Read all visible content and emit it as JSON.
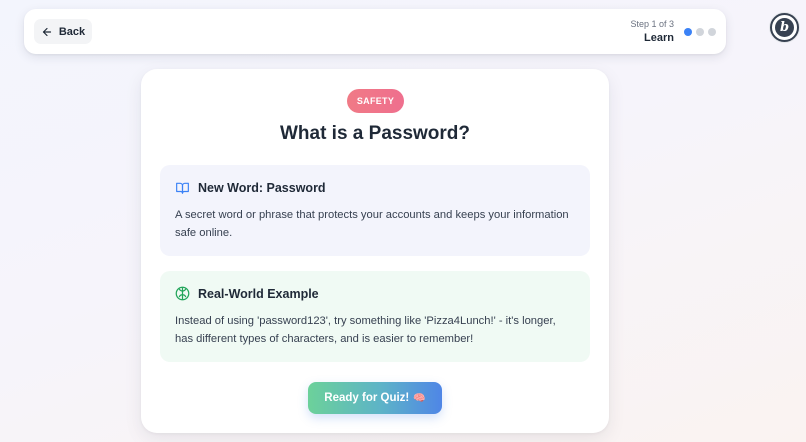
{
  "topbar": {
    "back_label": "Back",
    "step_count": "Step 1 of 3",
    "step_name": "Learn",
    "total_steps": 3,
    "current_step": 1,
    "colors": {
      "active_dot": "#3b82f6",
      "inactive_dot": "#d1d5db"
    }
  },
  "logo": {
    "letter": "b"
  },
  "lesson": {
    "category_badge": "SAFETY",
    "title": "What is a Password?",
    "definition": {
      "heading": "New Word: Password",
      "text": "A secret word or phrase that protects your accounts and keeps your information safe online."
    },
    "example": {
      "heading": "Real-World Example",
      "text": "Instead of using 'password123', try something like 'Pizza4Lunch!' - it's longer, has different types of characters, and is easier to remember!"
    },
    "quiz_button": "Ready for Quiz!",
    "quiz_button_emoji": "🧠"
  },
  "icons": {
    "back": "arrow-left-icon",
    "definition": "book-open-icon",
    "example": "brain-icon",
    "quiz": "brain-emoji"
  },
  "theme": {
    "badge_color": "#f07a86",
    "definition_bg": "#f3f4fc",
    "example_bg": "#f0faf4",
    "definition_icon": "#3b82f6",
    "example_icon": "#22a55a"
  }
}
